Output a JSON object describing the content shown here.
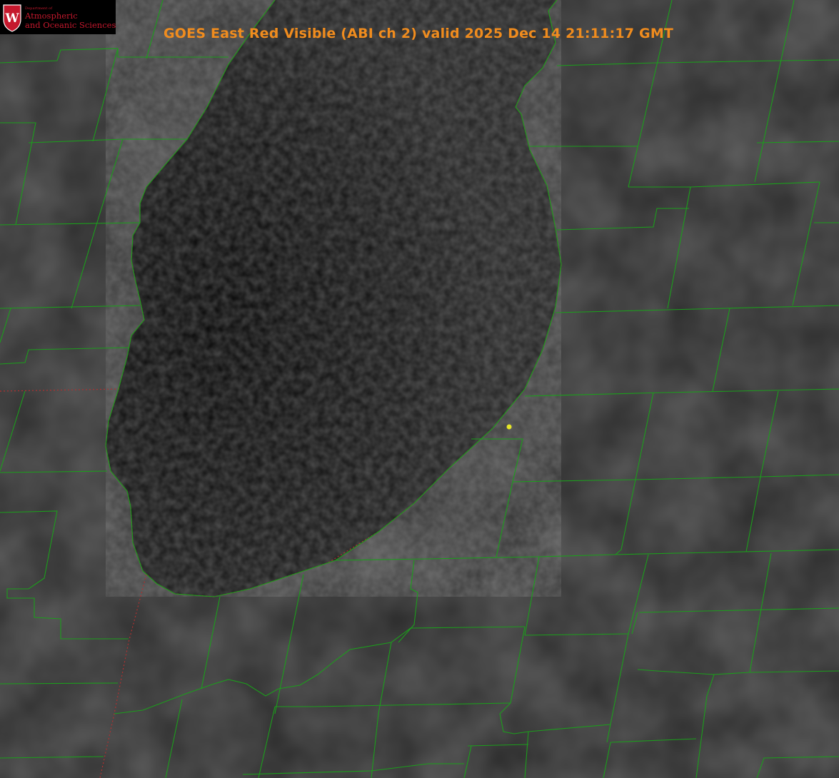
{
  "title": "GOES East Red Visible (ABI ch 2) valid 2025 Dec 14 21:11:17 GMT",
  "logo": {
    "department": "Department of",
    "line1": "Atmospheric",
    "line2": "and Oceanic Sciences",
    "crest_letter": "W",
    "crest_icon": "uw-crest-icon"
  },
  "colors": {
    "title": "#f08c1e",
    "county_lines": "#1c9e1c",
    "state_lines": "#b03030",
    "logo_text": "#c5182d",
    "marker": "#e6e628"
  },
  "features": {
    "lake": "Lake Michigan (dark water, textured surface)",
    "marker": "yellow dot"
  }
}
